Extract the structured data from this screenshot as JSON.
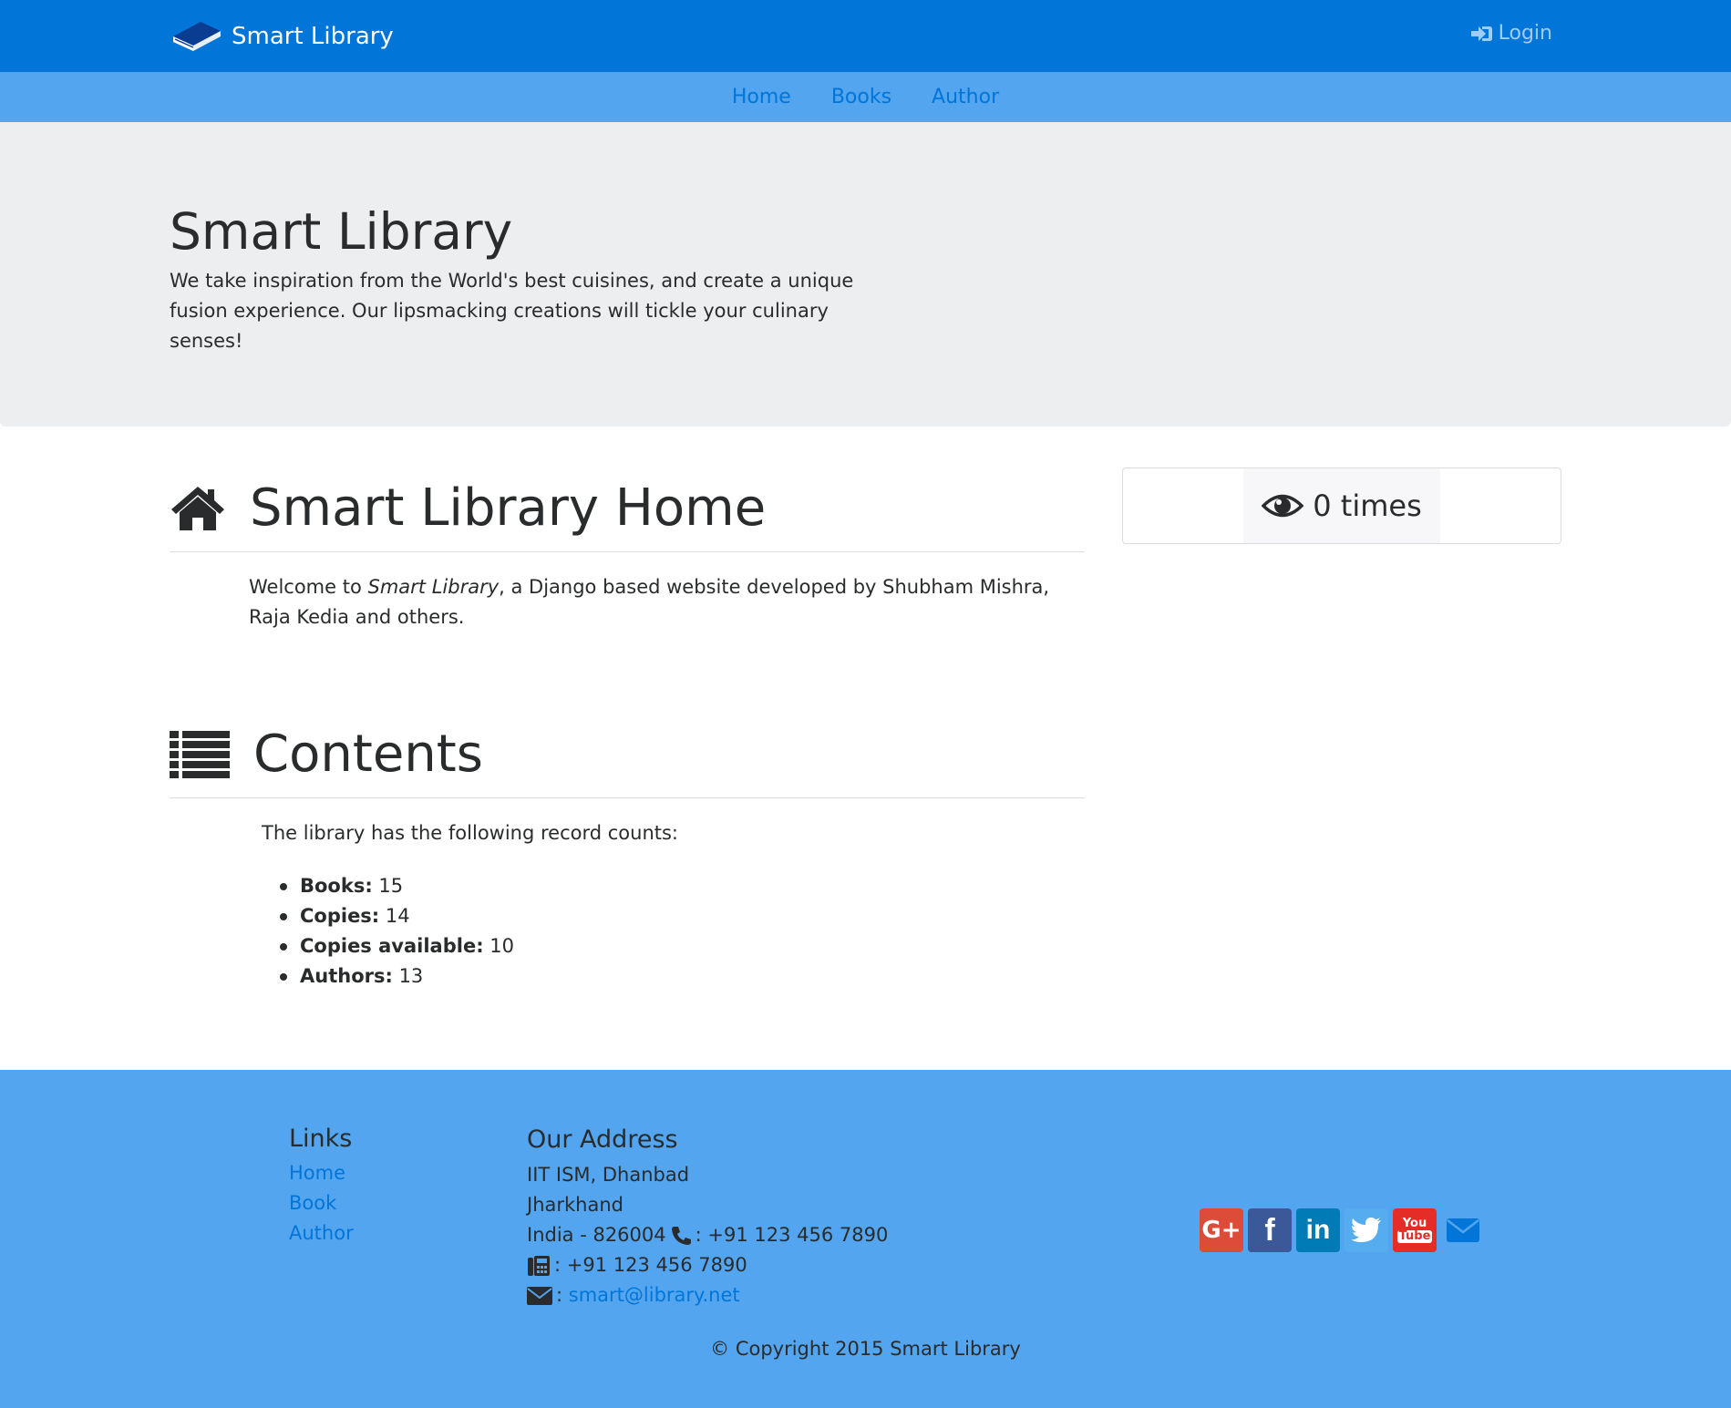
{
  "navbar": {
    "brand": "Smart Library",
    "login_label": "Login"
  },
  "subnav": {
    "items": [
      "Home",
      "Books",
      "Author"
    ]
  },
  "jumbotron": {
    "title": "Smart Library",
    "text": "We take inspiration from the World's best cuisines, and create a unique fusion experience. Our lipsmacking creations will tickle your culinary senses!"
  },
  "home": {
    "heading": "Smart Library Home",
    "welcome_prefix": "Welcome to ",
    "welcome_em": "Smart Library",
    "welcome_suffix": ", a Django based website developed by Shubham Mishra, Raja Kedia and others."
  },
  "views": {
    "text": "0 times"
  },
  "contents": {
    "heading": "Contents",
    "intro": "The library has the following record counts:",
    "records": [
      {
        "label": "Books:",
        "value": "15"
      },
      {
        "label": "Copies:",
        "value": "14"
      },
      {
        "label": "Copies available:",
        "value": "10"
      },
      {
        "label": "Authors:",
        "value": "13"
      }
    ]
  },
  "footer": {
    "links_title": "Links",
    "links": [
      "Home",
      "Book",
      "Author"
    ],
    "address_title": "Our Address",
    "address_line1": "IIT ISM, Dhanbad",
    "address_line2": "Jharkhand",
    "address_line3": "India - 826004",
    "phone": ": +91 123 456 7890",
    "fax": ": +91 123 456 7890",
    "email_prefix": ":",
    "email": "smart@library.net",
    "social": [
      "google-plus-icon",
      "facebook-icon",
      "linkedin-icon",
      "twitter-icon",
      "youtube-icon",
      "envelope-icon"
    ],
    "copyright": "© Copyright 2015 Smart Library"
  },
  "colors": {
    "primary": "#0275d8",
    "light_blue": "#52a5ee",
    "jumbotron_bg": "#eceeef"
  }
}
